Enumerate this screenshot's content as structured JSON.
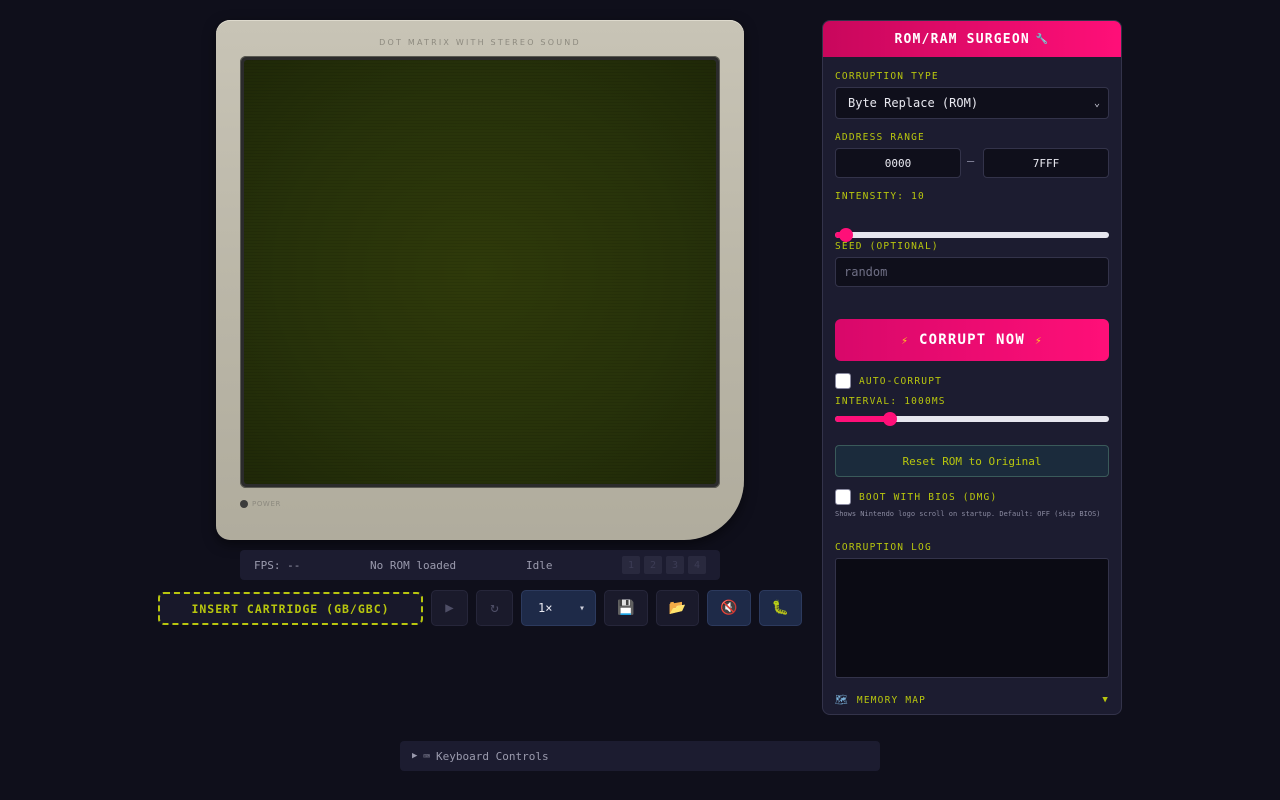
{
  "gameboy": {
    "label": "DOT MATRIX WITH STEREO SOUND",
    "power_label": "POWER"
  },
  "status": {
    "fps": "FPS: --",
    "rom": "No ROM loaded",
    "state": "Idle",
    "slots": [
      "1",
      "2",
      "3",
      "4"
    ]
  },
  "controls": {
    "insert_label": "INSERT CARTRIDGE (GB/GBC)",
    "play_icon": "▶",
    "reset_icon": "↻",
    "speed_value": "1×",
    "save_icon": "💾",
    "load_icon": "📂",
    "mute_icon": "🔇",
    "debug_icon": "🐛"
  },
  "keyboard": {
    "caret": "▶",
    "icon": "⌨",
    "label": "Keyboard Controls"
  },
  "panel": {
    "title": "ROM/RAM SURGEON",
    "title_icon": "🔧",
    "corruption_type_label": "CORRUPTION TYPE",
    "corruption_type_value": "Byte Replace (ROM)",
    "address_range_label": "ADDRESS RANGE",
    "address_start": "0000",
    "address_end": "7FFF",
    "address_separator": "—",
    "intensity_label": "INTENSITY: 10",
    "intensity_level": 0.04,
    "seed_label": "SEED (OPTIONAL)",
    "seed_placeholder": "random",
    "corrupt_label": "CORRUPT NOW",
    "bolt_icon": "⚡",
    "auto_corrupt_label": "AUTO-CORRUPT",
    "auto_corrupt_checked": false,
    "interval_label": "INTERVAL: 1000MS",
    "interval_level": 0.2,
    "reset_rom_label": "Reset ROM to Original",
    "bios_label": "BOOT WITH BIOS (DMG)",
    "bios_checked": false,
    "bios_note": "Shows Nintendo logo scroll on startup. Default: OFF (skip BIOS)",
    "log_label": "CORRUPTION LOG",
    "memory_map_icon": "🗺",
    "memory_map_label": "MEMORY MAP",
    "memory_map_toggle": "▼"
  },
  "colors": {
    "accent": "#ff0f78",
    "label": "#b8c60e",
    "background": "#0f0f1b",
    "panel": "#1c1c30"
  }
}
